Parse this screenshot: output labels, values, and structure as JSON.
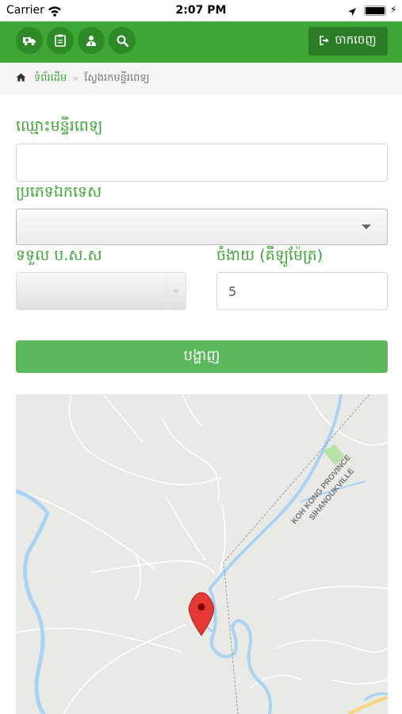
{
  "status_bar": {
    "carrier": "Carrier",
    "time": "2:07 PM"
  },
  "navbar": {
    "icons": [
      "ambulance-icon",
      "clipboard-icon",
      "doctor-icon",
      "search-icon"
    ],
    "logout_label": "ចាកចេញ"
  },
  "breadcrumb": {
    "home": "ទំព័រដើម",
    "separator": "»",
    "current": "ស្វែងរកមន្ទីរពេទ្យ"
  },
  "form": {
    "hospital_name_label": "ឈ្មោះមន្ទីរពេទ្យ",
    "hospital_name_value": "",
    "specialty_label": "ប្រភេទឯកទេស",
    "specialty_value": "",
    "accepts_label": "ទទួល ប.ស.ស",
    "accepts_value": "",
    "distance_label": "ចំងាយ (គីឡូម៉ែត្រ)",
    "distance_value": "5",
    "show_button": "បង្ហាញ"
  },
  "map": {
    "boundary_label_1": "KOH KONG PROVINCE",
    "boundary_label_2": "SIHANOUKVILLE",
    "marker": "map-pin-icon"
  },
  "colors": {
    "brand_green": "#3ea537",
    "button_green": "#5cb85c",
    "dark_green": "#2a7d24",
    "water": "#a8d3f5",
    "map_land": "#e9e9e6",
    "marker_red": "#e53935"
  }
}
